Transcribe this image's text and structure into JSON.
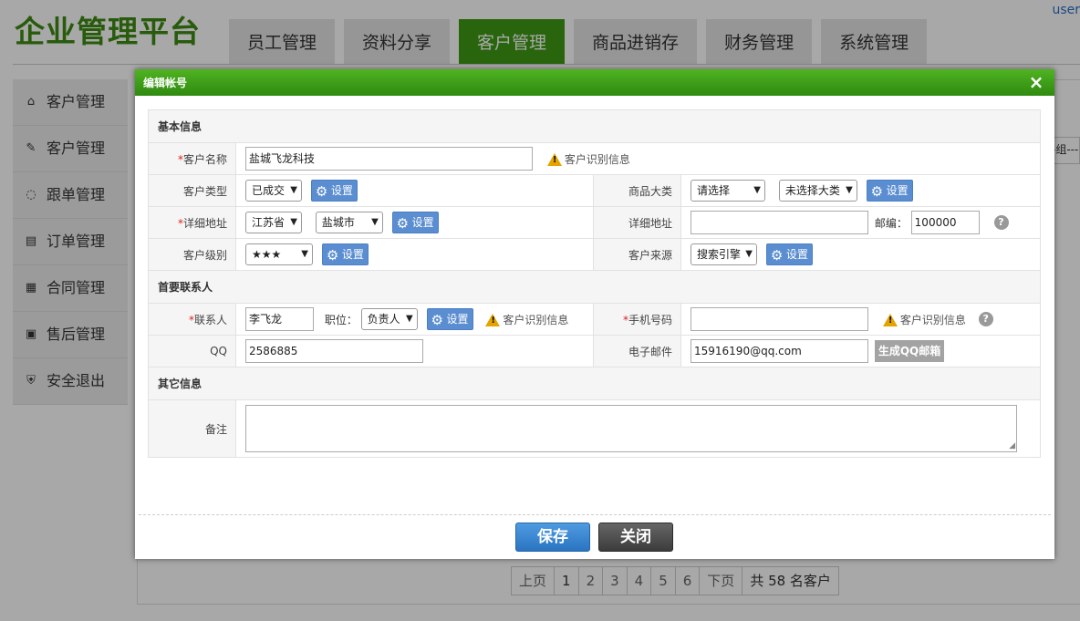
{
  "app": {
    "title": "企业管理平台",
    "user": "user"
  },
  "nav_tabs": [
    "员工管理",
    "资料分享",
    "客户管理",
    "商品进销存",
    "财务管理",
    "系统管理"
  ],
  "sidebar": [
    {
      "label": "客户管理",
      "icon": "home-icon"
    },
    {
      "label": "客户管理",
      "icon": "edit-icon"
    },
    {
      "label": "跟单管理",
      "icon": "chat-icon"
    },
    {
      "label": "订单管理",
      "icon": "document-icon"
    },
    {
      "label": "合同管理",
      "icon": "contract-icon"
    },
    {
      "label": "售后管理",
      "icon": "service-icon"
    },
    {
      "label": "安全退出",
      "icon": "logout-icon"
    }
  ],
  "background": {
    "group_select_stub": "-组---"
  },
  "pager": {
    "prev": "上页",
    "pages": [
      "1",
      "2",
      "3",
      "4",
      "5",
      "6"
    ],
    "next": "下页",
    "summary": "共 58 名客户"
  },
  "dialog": {
    "title": "编辑帐号",
    "close_icon": "×",
    "sections": {
      "basic": "基本信息",
      "contact": "首要联系人",
      "other": "其它信息"
    },
    "set_label": "设置",
    "warn_text": "客户识别信息",
    "fields": {
      "customer_name": {
        "label": "客户名称",
        "value": "盐城飞龙科技"
      },
      "customer_type": {
        "label": "客户类型",
        "value": "已成交"
      },
      "product_category": {
        "label": "商品大类",
        "value": "请选择",
        "value2": "未选择大类"
      },
      "address_region": {
        "label": "详细地址",
        "province": "江苏省",
        "city": "盐城市"
      },
      "address_detail": {
        "label": "详细地址",
        "value": ""
      },
      "postcode": {
        "label": "邮编：",
        "value": "100000"
      },
      "customer_level": {
        "label": "客户级别",
        "value": "★★★"
      },
      "customer_source": {
        "label": "客户来源",
        "value": "搜索引擎"
      },
      "contact": {
        "label": "联系人",
        "value": "李飞龙"
      },
      "position": {
        "label": "职位：",
        "value": "负责人"
      },
      "mobile": {
        "label": "手机号码",
        "value": ""
      },
      "qq": {
        "label": "QQ",
        "value": "2586885"
      },
      "email": {
        "label": "电子邮件",
        "value": "15916190@qq.com"
      },
      "gen_qq_mail": "生成QQ邮箱",
      "remark": {
        "label": "备注",
        "value": ""
      }
    },
    "buttons": {
      "save": "保存",
      "close": "关闭"
    }
  },
  "colors": {
    "brand_green": "#3e9a14",
    "header_green": "#2f8a10",
    "save_blue": "#2a74c2",
    "set_blue": "#5b8ed1"
  }
}
